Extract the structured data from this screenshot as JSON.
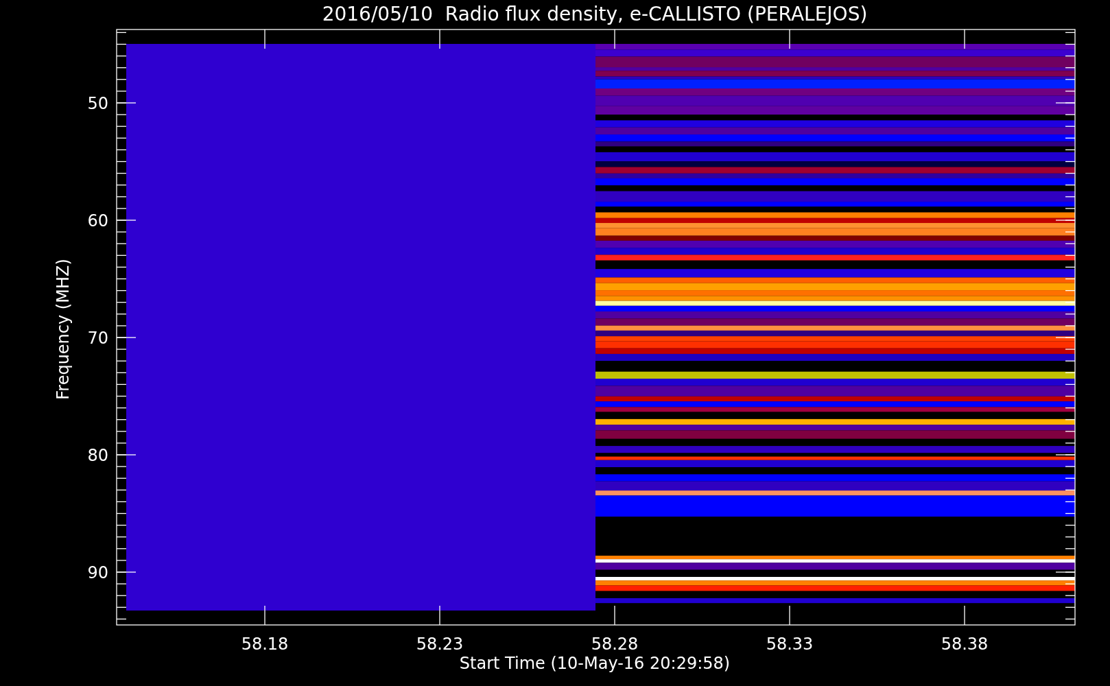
{
  "title": "2016/05/10  Radio flux density, e-CALLISTO (PERALEJOS)",
  "ylabel": "Frequency (MHZ)",
  "yticks": [
    "50",
    "60",
    "70",
    "80",
    "90"
  ],
  "xticks": [
    "58.18",
    "58.23",
    "58.28",
    "58.33",
    "58.38"
  ],
  "xlabel": "Start Time (10-May-16 20:29:58)"
}
